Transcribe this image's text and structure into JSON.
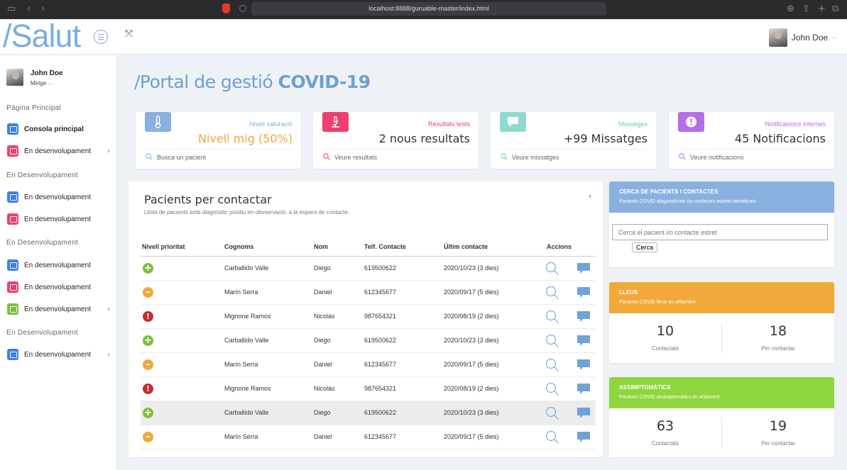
{
  "browser": {
    "url": "localhost:8888/guruable-master/index.html",
    "back": "‹",
    "forward": "›"
  },
  "app": {
    "logo": "/Salut",
    "user_name": "John Doe"
  },
  "sidebar": {
    "user": {
      "name": "John Doe",
      "role": "Metge"
    },
    "sections": [
      {
        "title": "Pàgina Principal"
      },
      {
        "title": "En Desenvolupament"
      },
      {
        "title": "En Desenvolupament"
      },
      {
        "title": "En Desenvolupament"
      }
    ],
    "items": [
      {
        "label": "Consola principal",
        "color": "#3f7fe8"
      },
      {
        "label": "En desenvolupament",
        "color": "#ee3f6e"
      },
      {
        "label": "En desenvolupament",
        "color": "#3f7fe8"
      },
      {
        "label": "En desenvolupament",
        "color": "#ee3f6e"
      },
      {
        "label": "En desenvolupament",
        "color": "#3f7fe8"
      },
      {
        "label": "En desenvolupament",
        "color": "#ee3f6e"
      },
      {
        "label": "En desenvolupament",
        "color": "#7cbf3f"
      },
      {
        "label": "En desenvolupament",
        "color": "#3f7fe8"
      }
    ]
  },
  "page": {
    "title_prefix": "/Portal de gestió",
    "title_bold": "COVID-19"
  },
  "cards": [
    {
      "title": "Nivell saturació",
      "value": "Nivell mig (50%)",
      "footer": "Busca un pacient",
      "color": "#8ab0e0",
      "title_color": "#7aaee0",
      "value_color": "#f0a93a",
      "icon": "thermometer-icon"
    },
    {
      "title": "Resultats tests",
      "value": "2 nous resultats",
      "footer": "Veure resultats",
      "color": "#ee3f6e",
      "title_color": "#ee3f6e",
      "value_color": "#333333",
      "icon": "microscope-icon"
    },
    {
      "title": "Missatges",
      "value": "+99 Missatges",
      "footer": "Veure missatges",
      "color": "#8fdad0",
      "title_color": "#6cc7bb",
      "value_color": "#333333",
      "icon": "message-icon"
    },
    {
      "title": "Notificacions internes",
      "value": "45 Notificacions",
      "footer": "Veure notificacions",
      "color": "#b46fe5",
      "title_color": "#b46fe5",
      "value_color": "#333333",
      "icon": "alert-icon"
    }
  ],
  "patients_panel": {
    "title": "Pacients per contactar",
    "subtitle": "Llista de pacients amb diagnòstic positiu en obvservació, a la espera de contacte.",
    "collapse": "‹",
    "columns": [
      "Nivell prioritat",
      "Cognoms",
      "Nom",
      "Telf. Contacte",
      "Últim contacte",
      "Accions"
    ],
    "rows": [
      {
        "priority": "low",
        "surname": "Carballido Valle",
        "name": "Diego",
        "phone": "619500622",
        "last": "2020/10/23 (3 dies)"
      },
      {
        "priority": "medium",
        "surname": "Marín Serra",
        "name": "Daniel",
        "phone": "612345677",
        "last": "2020/09/17 (5 dies)"
      },
      {
        "priority": "high",
        "surname": "Mignone Ramos",
        "name": "Nicolás",
        "phone": "987654321",
        "last": "2020/08/19 (2 dies)"
      },
      {
        "priority": "low",
        "surname": "Carballido Valle",
        "name": "Diego",
        "phone": "619500622",
        "last": "2020/10/23 (3 dies)"
      },
      {
        "priority": "medium",
        "surname": "Marín Serra",
        "name": "Daniel",
        "phone": "612345677",
        "last": "2020/09/17 (5 dies)"
      },
      {
        "priority": "high",
        "surname": "Mignone Ramos",
        "name": "Nicolás",
        "phone": "987654321",
        "last": "2020/08/19 (2 dies)"
      },
      {
        "priority": "low",
        "surname": "Carballido Valle",
        "name": "Diego",
        "phone": "619500622",
        "last": "2020/10/23 (3 dies)"
      },
      {
        "priority": "medium",
        "surname": "Marín Serra",
        "name": "Daniel",
        "phone": "612345677",
        "last": "2020/09/17 (5 dies)"
      }
    ]
  },
  "search_panel": {
    "title": "CERCA DE PACIENTS I CONTACTES",
    "subtitle": "Pacients COVID diagnosticats i/o contactes estrets identificats",
    "placeholder": "Cerca el pacient i/o contacte estret",
    "button": "Cerca",
    "color": "#8ab0e0"
  },
  "mild_panel": {
    "title": "LLEUS",
    "subtitle": "Pacients COVID lleus en aïllament",
    "contacted": "10",
    "contacted_label": "Contactats",
    "pending": "18",
    "pending_label": "Per contactar",
    "color": "#f0a93a"
  },
  "asym_panel": {
    "title": "ASSIMPTOMÀTICS",
    "subtitle": "Pacients COVID assimptomàtics en aïllament",
    "contacted": "63",
    "contacted_label": "Contactats",
    "pending": "19",
    "pending_label": "Per contactar",
    "color": "#8fd63e"
  }
}
